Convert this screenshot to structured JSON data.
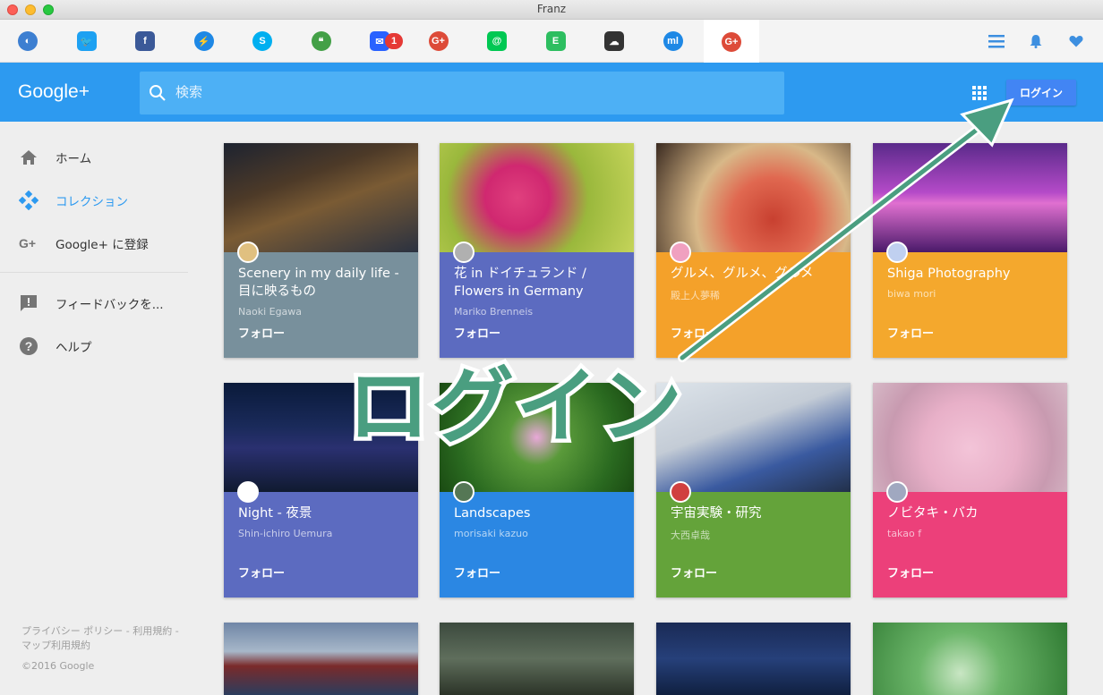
{
  "window": {
    "title": "Franz"
  },
  "services": [
    {
      "name": "franz-logo-icon",
      "bg": "#3d7fd1",
      "glyph": "◐",
      "round": true
    },
    {
      "name": "twitter-icon",
      "bg": "#1da1f2",
      "glyph": "🐦",
      "round": false
    },
    {
      "name": "facebook-icon",
      "bg": "#3b5998",
      "glyph": "f",
      "round": false
    },
    {
      "name": "messenger-icon",
      "bg": "#1e88e5",
      "glyph": "⚡",
      "round": true
    },
    {
      "name": "skype-icon",
      "bg": "#00aff0",
      "glyph": "S",
      "round": true
    },
    {
      "name": "hangouts-icon",
      "bg": "#43a047",
      "glyph": "❝",
      "round": true
    },
    {
      "name": "inbox-icon",
      "bg": "#2962ff",
      "glyph": "✉",
      "round": false,
      "badge": "1"
    },
    {
      "name": "google-plus-icon",
      "bg": "#dd4b39",
      "glyph": "G+",
      "round": true
    },
    {
      "name": "mail-at-icon",
      "bg": "#00c853",
      "glyph": "@",
      "round": false
    },
    {
      "name": "evernote-icon",
      "bg": "#2dbe60",
      "glyph": "E",
      "round": false
    },
    {
      "name": "icloud-icon",
      "bg": "#333333",
      "glyph": "☁",
      "round": false
    },
    {
      "name": "mailru-icon",
      "bg": "#1e88e5",
      "glyph": "ml",
      "round": true
    },
    {
      "name": "google-plus-active-icon",
      "bg": "#dd4b39",
      "glyph": "G+",
      "round": true
    }
  ],
  "gplus": {
    "logo": "Google+",
    "search_placeholder": "検索",
    "login_label": "ログイン"
  },
  "sidebar": {
    "items": [
      {
        "name": "home",
        "label": "ホーム",
        "active": false
      },
      {
        "name": "collections",
        "label": "コレクション",
        "active": true
      },
      {
        "name": "signup",
        "label": "Google+ に登録",
        "active": false
      },
      {
        "name": "feedback",
        "label": "フィードバックを...",
        "active": false
      },
      {
        "name": "help",
        "label": "ヘルプ",
        "active": false
      }
    ],
    "footer": "プライバシー ポリシー - 利用規約 - マップ利用規約",
    "copyright": "©2016 Google"
  },
  "cards": [
    {
      "title": "Scenery in my daily life - 目に映るもの",
      "author": "Naoki Egawa",
      "follow": "フォロー",
      "color": "#78909c"
    },
    {
      "title": "花 in ドイチュランド / Flowers in Germany",
      "author": "Mariko Brenneis",
      "follow": "フォロー",
      "color": "#5c6bc0"
    },
    {
      "title": "グルメ、グルメ、グルメ",
      "author": "殿上人夢稀",
      "follow": "フォロー",
      "color": "#f4a12a"
    },
    {
      "title": "Shiga Photography",
      "author": "biwa mori",
      "follow": "フォロー",
      "color": "#f4a82d"
    },
    {
      "title": "Night - 夜景",
      "author": "Shin-ichiro Uemura",
      "follow": "フォロー",
      "color": "#5c6bc0"
    },
    {
      "title": "Landscapes",
      "author": "morisaki kazuo",
      "follow": "フォロー",
      "color": "#2b87e3"
    },
    {
      "title": "宇宙実験・研究",
      "author": "大西卓哉",
      "follow": "フォロー",
      "color": "#64a33a"
    },
    {
      "title": "ノビタキ・バカ",
      "author": "takao f",
      "follow": "フォロー",
      "color": "#ec407a"
    }
  ],
  "overlay": {
    "text": "ログイン"
  }
}
